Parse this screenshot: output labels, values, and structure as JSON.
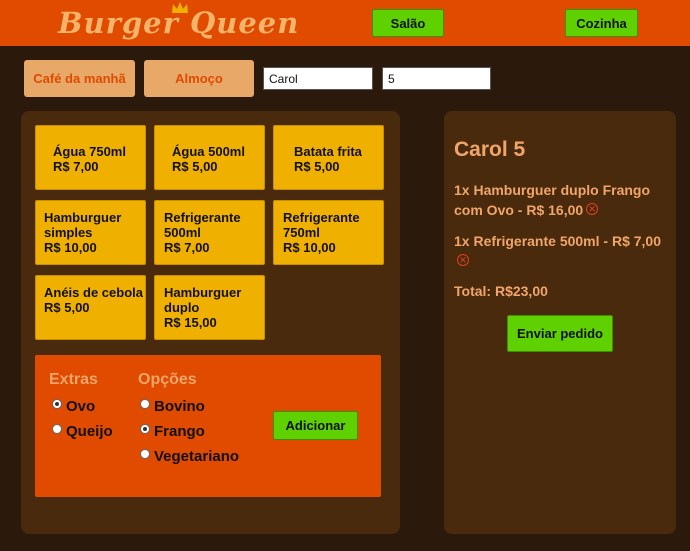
{
  "brand": {
    "logo_text": "Burger Queen"
  },
  "nav": {
    "salao": "Salão",
    "cozinha": "Cozinha"
  },
  "menu_tabs": {
    "breakfast": "Café da manhã",
    "lunch": "Almoço"
  },
  "inputs": {
    "client_name": "Carol",
    "table_number": "5"
  },
  "products": [
    {
      "name": "Água 750ml",
      "price": "R$ 7,00"
    },
    {
      "name": "Água 500ml",
      "price": "R$ 5,00"
    },
    {
      "name": "Batata frita",
      "price": "R$ 5,00"
    },
    {
      "name": "Hamburguer simples",
      "price": "R$ 10,00"
    },
    {
      "name": "Refrigerante 500ml",
      "price": "R$ 7,00"
    },
    {
      "name": "Refrigerante 750ml",
      "price": "R$ 10,00"
    },
    {
      "name": "Anéis de cebola",
      "price": "R$ 5,00"
    },
    {
      "name": "Hamburguer duplo",
      "price": "R$ 15,00"
    }
  ],
  "extras": {
    "title": "Extras",
    "items": [
      {
        "label": "Ovo",
        "checked": true
      },
      {
        "label": "Queijo",
        "checked": false
      }
    ]
  },
  "opcoes": {
    "title": "Opções",
    "items": [
      {
        "label": "Bovino",
        "checked": false
      },
      {
        "label": "Frango",
        "checked": true
      },
      {
        "label": "Vegetariano",
        "checked": false
      }
    ]
  },
  "add_button": "Adicionar",
  "order": {
    "title": "Carol 5",
    "items": [
      {
        "text": "1x Hamburguer duplo Frango com Ovo - R$ 16,00"
      },
      {
        "text": "1x Refrigerante 500ml - R$ 7,00"
      }
    ],
    "total": "Total: R$23,00",
    "send_button": "Enviar pedido"
  },
  "colors": {
    "header": "#e04b00",
    "background": "#2b1a0b",
    "panel": "#4a2a0c",
    "card": "#f0b000",
    "button": "#5fd000",
    "accent_text": "#f0a56a"
  }
}
